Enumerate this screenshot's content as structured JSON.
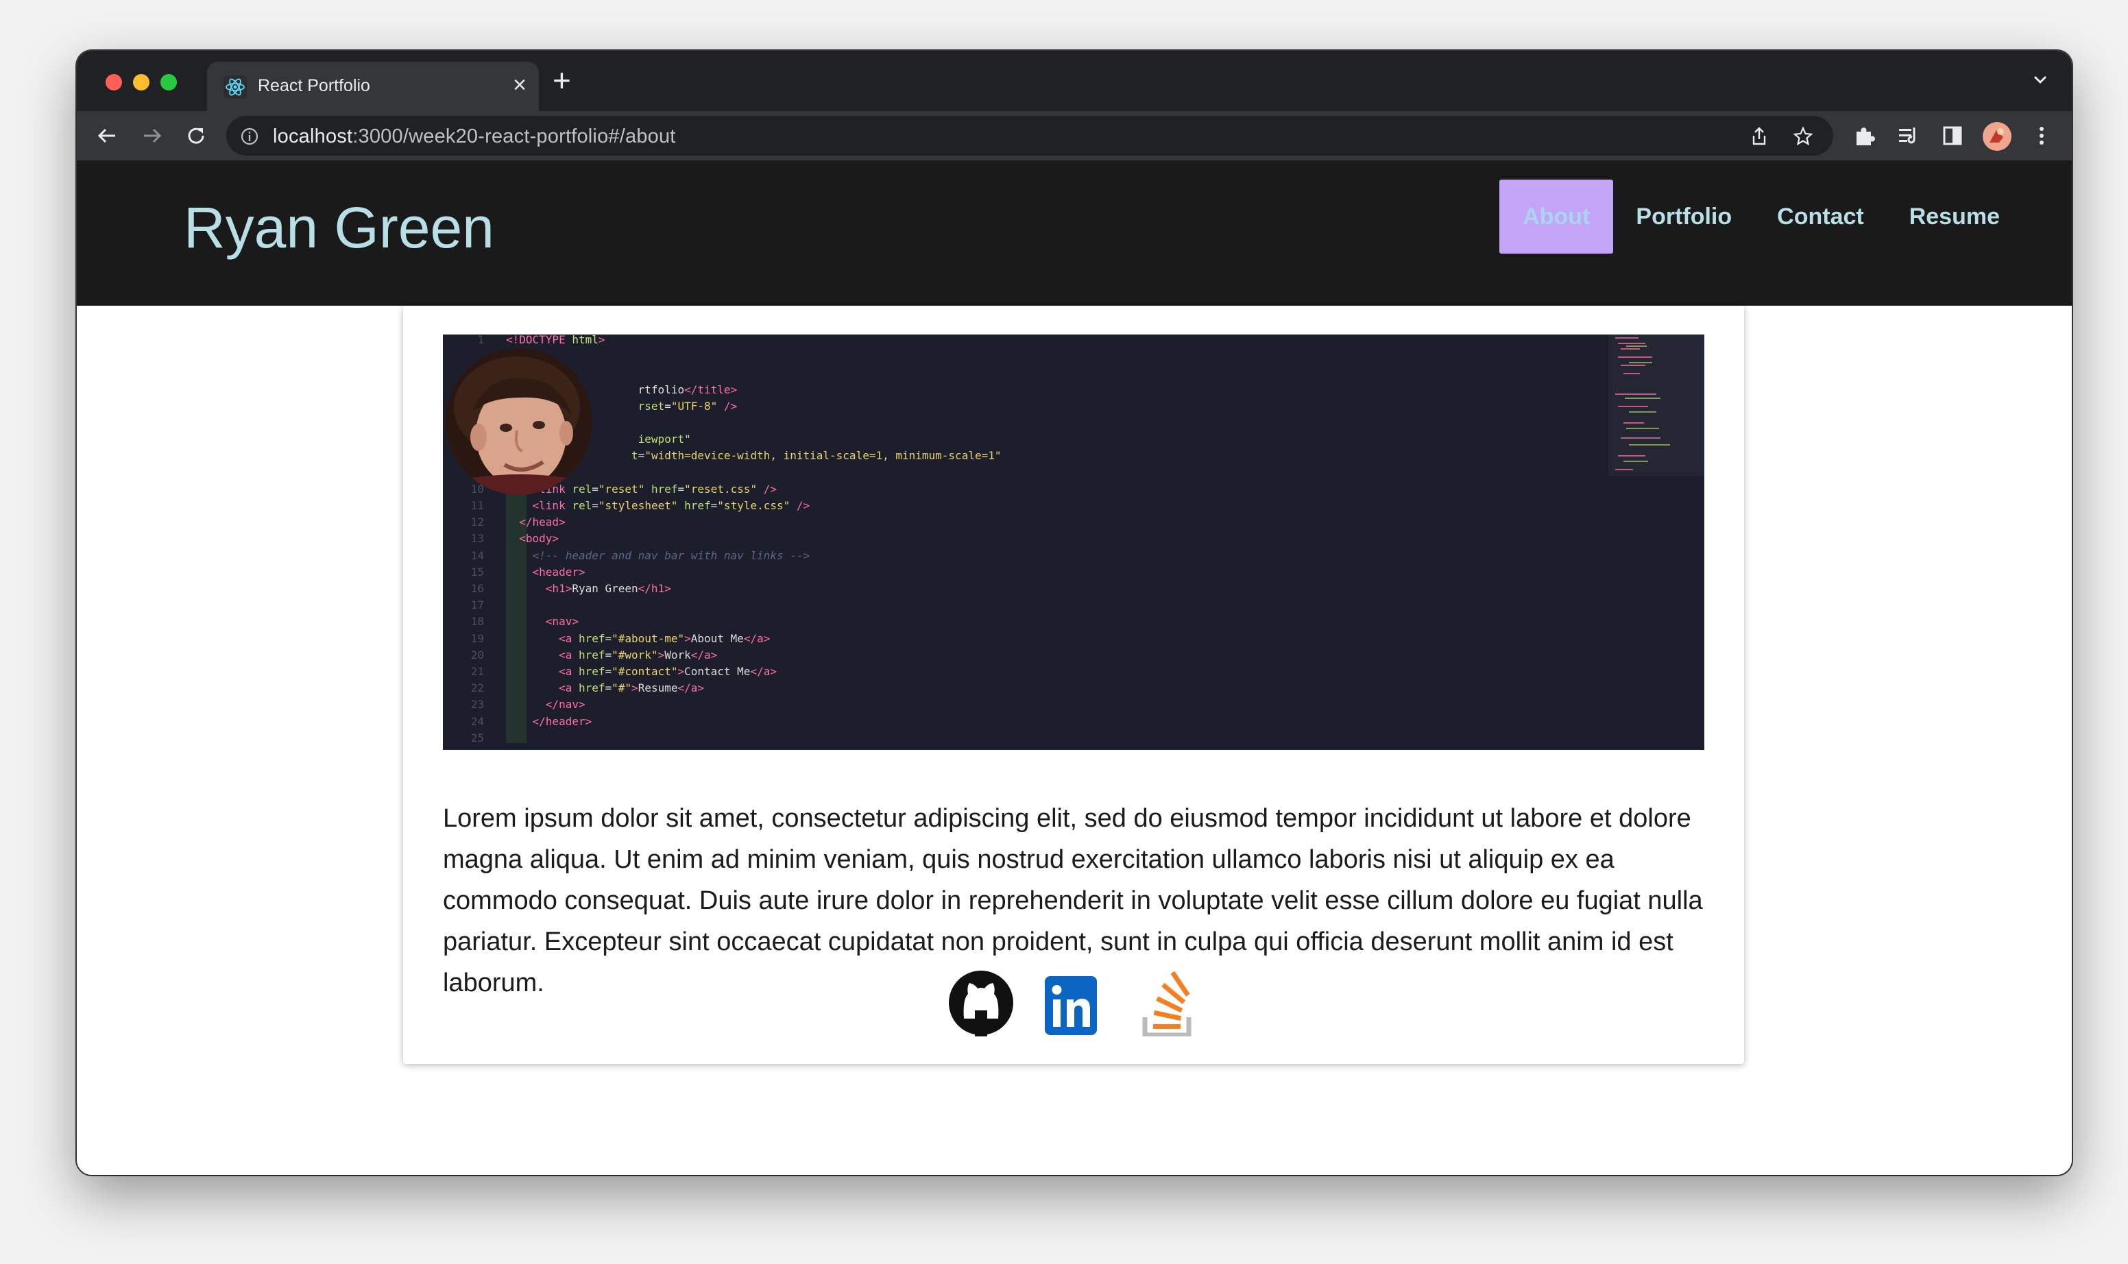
{
  "browser": {
    "tab_title": "React Portfolio",
    "tab_close": "×",
    "new_tab": "+",
    "url_host": "localhost",
    "url_rest": ":3000/week20-react-portfolio#/about"
  },
  "site": {
    "title": "Ryan Green",
    "nav": [
      {
        "label": "About",
        "active": true
      },
      {
        "label": "Portfolio",
        "active": false
      },
      {
        "label": "Contact",
        "active": false
      },
      {
        "label": "Resume",
        "active": false
      }
    ]
  },
  "about": {
    "bio": "Lorem ipsum dolor sit amet, consectetur adipiscing elit, sed do eiusmod tempor incididunt ut labore et dolore magna aliqua. Ut enim ad minim veniam, quis nostrud exercitation ullamco laboris nisi ut aliquip ex ea commodo consequat. Duis aute irure dolor in reprehenderit in voluptate velit esse cillum dolore eu fugiat nulla pariatur. Excepteur sint occaecat cupidatat non proident, sunt in culpa qui officia deserunt mollit anim id est laborum.",
    "code_lines": [
      {
        "n": "1",
        "html": "<span class=\"tag\">&lt;!DOCTYPE</span> <span class=\"attr\">html</span><span class=\"tag\">&gt;</span>"
      },
      {
        "n": "",
        "html": ""
      },
      {
        "n": "",
        "html": ""
      },
      {
        "n": "",
        "html": "                    <span class=\"txt\">rtfolio</span><span class=\"tag\">&lt;/title&gt;</span>"
      },
      {
        "n": "",
        "html": "                    <span class=\"attr\">rset</span>=<span class=\"str\">\"UTF-8\"</span> <span class=\"tag\">/&gt;</span>"
      },
      {
        "n": "",
        "html": ""
      },
      {
        "n": "",
        "html": "                    <span class=\"attr\">iewport\"</span>"
      },
      {
        "n": "",
        "html": "                   <span class=\"attr\">t</span>=<span class=\"str\">\"width=device-width, initial-scale=1, minimum-scale=1\"</span>"
      },
      {
        "n": "",
        "html": ""
      },
      {
        "n": "10",
        "html": "    <span class=\"tag\">&lt;link</span> <span class=\"attr\">rel</span>=<span class=\"str\">\"reset\"</span> <span class=\"attr\">href</span>=<span class=\"str\">\"reset.css\"</span> <span class=\"tag\">/&gt;</span>"
      },
      {
        "n": "11",
        "html": "    <span class=\"tag\">&lt;link</span> <span class=\"attr\">rel</span>=<span class=\"str\">\"stylesheet\"</span> <span class=\"attr\">href</span>=<span class=\"str\">\"style.css\"</span> <span class=\"tag\">/&gt;</span>"
      },
      {
        "n": "12",
        "html": "  <span class=\"tag\">&lt;/head&gt;</span>"
      },
      {
        "n": "13",
        "html": "  <span class=\"tag\">&lt;body&gt;</span>"
      },
      {
        "n": "14",
        "html": "    <span class=\"cmt\">&lt;!-- header and nav bar with nav links --&gt;</span>"
      },
      {
        "n": "15",
        "html": "    <span class=\"tag\">&lt;header&gt;</span>"
      },
      {
        "n": "16",
        "html": "      <span class=\"tag\">&lt;h1&gt;</span><span class=\"txt\">Ryan Green</span><span class=\"tag\">&lt;/h1&gt;</span>"
      },
      {
        "n": "17",
        "html": ""
      },
      {
        "n": "18",
        "html": "      <span class=\"tag\">&lt;nav&gt;</span>"
      },
      {
        "n": "19",
        "html": "        <span class=\"tag\">&lt;a</span> <span class=\"attr\">href</span>=<span class=\"str\">\"#about-me\"</span><span class=\"tag\">&gt;</span><span class=\"txt\">About Me</span><span class=\"tag\">&lt;/a&gt;</span>"
      },
      {
        "n": "20",
        "html": "        <span class=\"tag\">&lt;a</span> <span class=\"attr\">href</span>=<span class=\"str\">\"#work\"</span><span class=\"tag\">&gt;</span><span class=\"txt\">Work</span><span class=\"tag\">&lt;/a&gt;</span>"
      },
      {
        "n": "21",
        "html": "        <span class=\"tag\">&lt;a</span> <span class=\"attr\">href</span>=<span class=\"str\">\"#contact\"</span><span class=\"tag\">&gt;</span><span class=\"txt\">Contact Me</span><span class=\"tag\">&lt;/a&gt;</span>"
      },
      {
        "n": "22",
        "html": "        <span class=\"tag\">&lt;a</span> <span class=\"attr\">href</span>=<span class=\"str\">\"#\"</span><span class=\"tag\">&gt;</span><span class=\"txt\">Resume</span><span class=\"tag\">&lt;/a&gt;</span>"
      },
      {
        "n": "23",
        "html": "      <span class=\"tag\">&lt;/nav&gt;</span>"
      },
      {
        "n": "24",
        "html": "    <span class=\"tag\">&lt;/header&gt;</span>"
      },
      {
        "n": "25",
        "html": ""
      }
    ]
  },
  "social": [
    "github-icon",
    "linkedin-icon",
    "stackoverflow-icon"
  ],
  "colors": {
    "header_bg": "#1a1a1a",
    "title": "#b9dfe6",
    "nav_active_bg": "#c4a4f6",
    "code_bg": "#1d1e2b"
  }
}
